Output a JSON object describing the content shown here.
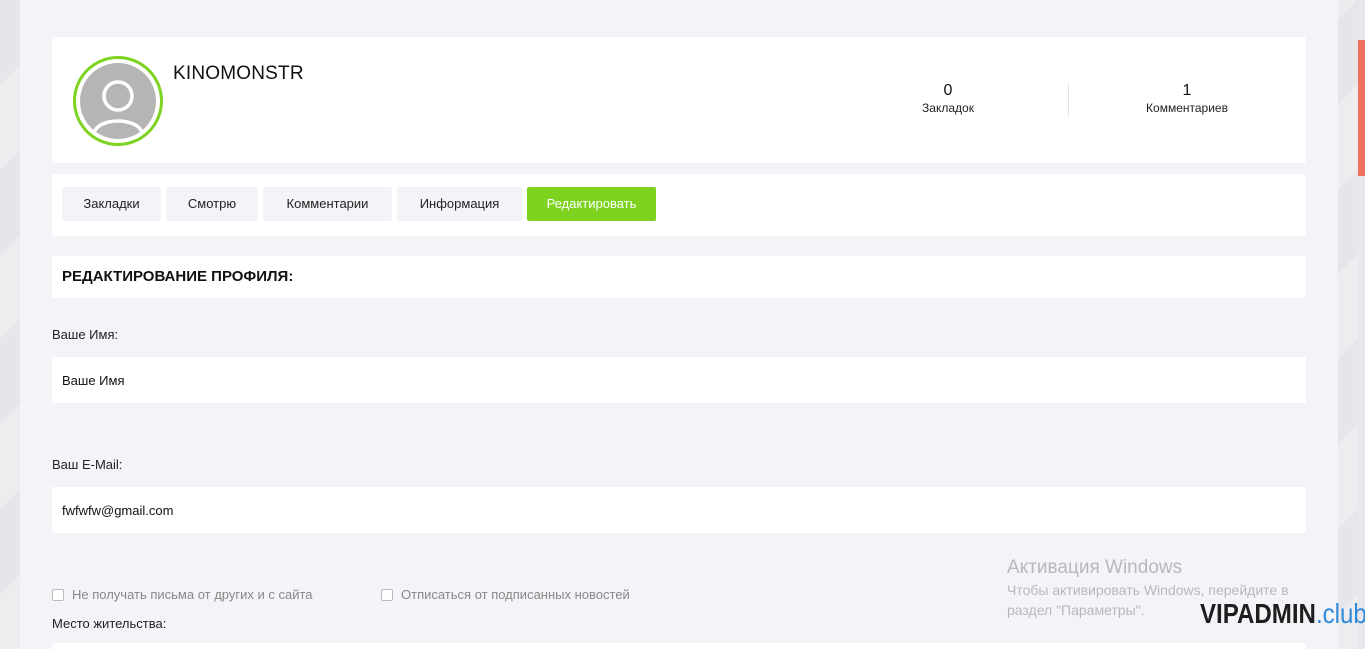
{
  "profile": {
    "username": "KINOMONSTR",
    "avatar_icon": "user-icon",
    "accent_color": "#7ed321",
    "stats": [
      {
        "value": "0",
        "label": "Закладок"
      },
      {
        "value": "1",
        "label": "Комментариев"
      }
    ]
  },
  "tabs": [
    {
      "label": "Закладки",
      "active": false
    },
    {
      "label": "Смотрю",
      "active": false
    },
    {
      "label": "Комментарии",
      "active": false
    },
    {
      "label": "Информация",
      "active": false
    },
    {
      "label": "Редактировать",
      "active": true
    }
  ],
  "section": {
    "title": "РЕДАКТИРОВАНИЕ ПРОФИЛЯ:"
  },
  "form": {
    "name_label": "Ваше Имя:",
    "name_value": "Ваше Имя",
    "email_label": "Ваш E-Mail:",
    "email_value": "fwfwfw@gmail.com",
    "checkbox_no_mail": "Не получать письма от других и с сайта",
    "checkbox_unsubscribe": "Отписаться от подписанных новостей",
    "location_label": "Место жительства:"
  },
  "windows_activation": {
    "title": "Активация Windows",
    "line1": "Чтобы активировать Windows, перейдите в",
    "line2": "раздел \"Параметры\"."
  },
  "watermark": {
    "main": "VIPADMIN",
    "tld": ".club"
  },
  "colors": {
    "scroll_thumb": "#f07060",
    "watermark_tld": "#2f8ad8"
  }
}
